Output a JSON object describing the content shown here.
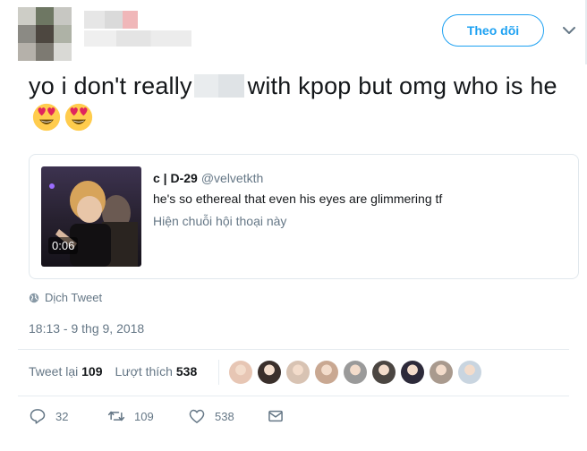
{
  "header": {
    "follow_label": "Theo dõi",
    "avatar_colors": [
      "#cdcdc6",
      "#6e7763",
      "#c7c7c2",
      "#8b8a84",
      "#4d4740",
      "#aeb2a6",
      "#b5b1aa",
      "#7d7a72",
      "#d9d9d5"
    ]
  },
  "tweet": {
    "text_before": "yo i don't really",
    "text_after": "with kpop but omg who is he"
  },
  "quote": {
    "display_name": "c | D-29",
    "handle": "@velvetkth",
    "text": "he's so ethereal that even his eyes are glimmering tf",
    "thread_link": "Hiện chuỗi hội thoại này",
    "video_duration": "0:06"
  },
  "meta": {
    "translate_label": "Dịch Tweet",
    "timestamp": "18:13 - 9 thg 9, 2018"
  },
  "stats": {
    "retweets_label": "Tweet lại",
    "retweets_count": "109",
    "likes_label": "Lượt thích",
    "likes_count": "538",
    "liker_colors": [
      "#e7c6b4",
      "#3a2f2b",
      "#d8c3b3",
      "#c9a892",
      "#9a9a9a",
      "#4b4642",
      "#2d2a3a",
      "#a99a8e",
      "#c9d5e0"
    ]
  },
  "actions": {
    "reply_count": "32",
    "retweet_count": "109",
    "like_count": "538"
  },
  "colors": {
    "accent": "#1da1f2",
    "secondary_text": "#657786",
    "emoji_face": "#ffcc4d",
    "emoji_heart": "#e0245e"
  }
}
